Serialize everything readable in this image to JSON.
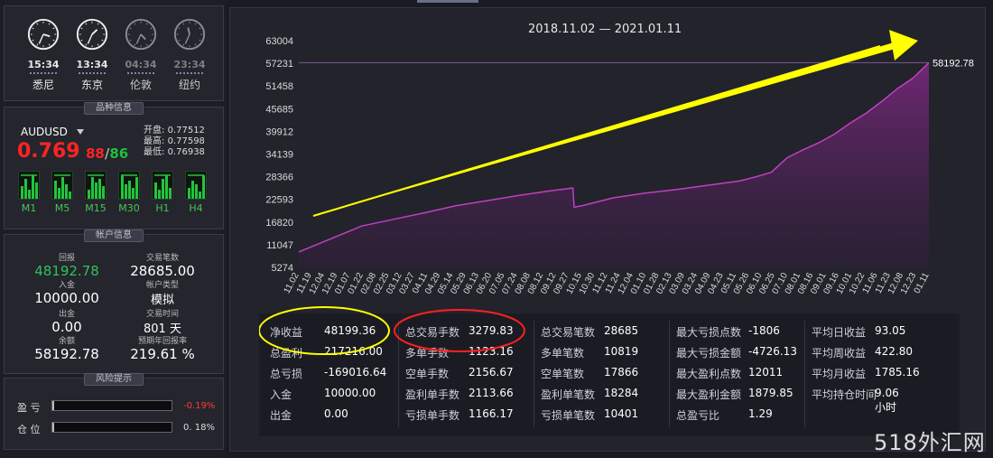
{
  "clocks": [
    {
      "time": "15:34",
      "city": "悉尼",
      "hour": 15,
      "minute": 34,
      "active": true
    },
    {
      "time": "13:34",
      "city": "东京",
      "hour": 13,
      "minute": 34,
      "active": true
    },
    {
      "time": "04:34",
      "city": "伦敦",
      "hour": 4,
      "minute": 34,
      "active": false
    },
    {
      "time": "23:34",
      "city": "纽约",
      "hour": 23,
      "minute": 34,
      "active": false
    }
  ],
  "symbol_panel": {
    "title": "品种信息",
    "symbol": "AUDUSD",
    "price_main": "0.769",
    "price_bid": "88",
    "price_sep": "/",
    "price_ask": "86",
    "open_label": "开盘:",
    "open": "0.77512",
    "high_label": "最高:",
    "high": "0.77598",
    "low_label": "最低:",
    "low": "0.76938",
    "timeframes": [
      "M1",
      "M5",
      "M15",
      "M30",
      "H1",
      "H4"
    ]
  },
  "account_panel": {
    "title": "帐户信息",
    "profit_label": "回报",
    "profit": "48192.78",
    "trades_label": "交易笔数",
    "trades": "28685.00",
    "deposit_label": "入金",
    "deposit": "10000.00",
    "account_type_label": "帐户类型",
    "account_type": "模拟",
    "withdraw_label": "出金",
    "withdraw": "0.00",
    "trade_time_label": "交易时间",
    "trade_time": "801 天",
    "balance_label": "余额",
    "balance": "58192.78",
    "annual_label": "预期年回报率",
    "annual": "219.61 %"
  },
  "risk_panel": {
    "title": "风险提示",
    "pl_label": "盈 亏",
    "pl_value": "-0.19%",
    "pl_fraction": 0.0019,
    "position_label": "仓 位",
    "position_value": "0. 18%",
    "position_fraction": 0.0018
  },
  "chart_data": {
    "type": "area",
    "title": "2018.11.02 — 2021.01.11",
    "last_value_label": "58192.78",
    "y_ticks": [
      "63004",
      "57231",
      "51458",
      "45685",
      "39912",
      "34139",
      "28366",
      "22593",
      "16820",
      "11047",
      "5274"
    ],
    "ylim": [
      5274,
      63004
    ],
    "x_ticks": [
      "11.02",
      "11.19",
      "12.04",
      "12.19",
      "01.07",
      "01.22",
      "02.08",
      "02.25",
      "03.12",
      "03.27",
      "04.11",
      "04.29",
      "05.14",
      "05.29",
      "06.13",
      "06.20",
      "07.05",
      "07.24",
      "08.08",
      "08.12",
      "09.12",
      "09.27",
      "10.15",
      "10.30",
      "11.12",
      "11.24",
      "12.04",
      "01.10",
      "01.28",
      "02.13",
      "03.09",
      "03.24",
      "04.09",
      "04.23",
      "05.11",
      "05.26",
      "06.10",
      "06.25",
      "07.10",
      "08.01",
      "08.16",
      "09.01",
      "09.16",
      "10.01",
      "10.22",
      "11.06",
      "11.23",
      "12.08",
      "12.23",
      "01.11"
    ],
    "series": [
      {
        "color": "#c040c0",
        "points": [
          [
            0,
            9200
          ],
          [
            0.05,
            12500
          ],
          [
            0.1,
            15800
          ],
          [
            0.15,
            17500
          ],
          [
            0.2,
            19200
          ],
          [
            0.25,
            21000
          ],
          [
            0.3,
            22300
          ],
          [
            0.35,
            23600
          ],
          [
            0.4,
            24800
          ],
          [
            0.435,
            25500
          ],
          [
            0.437,
            20600
          ],
          [
            0.45,
            21000
          ],
          [
            0.5,
            23000
          ],
          [
            0.55,
            24200
          ],
          [
            0.6,
            25100
          ],
          [
            0.65,
            26200
          ],
          [
            0.7,
            27300
          ],
          [
            0.725,
            28300
          ],
          [
            0.75,
            29500
          ],
          [
            0.775,
            33200
          ],
          [
            0.8,
            35200
          ],
          [
            0.825,
            37000
          ],
          [
            0.85,
            39200
          ],
          [
            0.875,
            42000
          ],
          [
            0.9,
            44500
          ],
          [
            0.925,
            47500
          ],
          [
            0.95,
            50800
          ],
          [
            0.975,
            53500
          ],
          [
            1.0,
            57400
          ]
        ]
      }
    ],
    "overlay_arrow": {
      "color": "#ffff00"
    }
  },
  "stats": {
    "columns": [
      [
        {
          "k": "净收益",
          "v": "48199.36"
        },
        {
          "k": "总盈利",
          "v": "217216.00"
        },
        {
          "k": "总亏损",
          "v": "-169016.64"
        },
        {
          "k": "入金",
          "v": "10000.00"
        },
        {
          "k": "出金",
          "v": "0.00"
        }
      ],
      [
        {
          "k": "总交易手数",
          "v": "3279.83"
        },
        {
          "k": "多单手数",
          "v": "1123.16"
        },
        {
          "k": "空单手数",
          "v": "2156.67"
        },
        {
          "k": "盈利单手数",
          "v": "2113.66"
        },
        {
          "k": "亏损单手数",
          "v": "1166.17"
        }
      ],
      [
        {
          "k": "总交易笔数",
          "v": "28685"
        },
        {
          "k": "多单笔数",
          "v": "10819"
        },
        {
          "k": "空单笔数",
          "v": "17866"
        },
        {
          "k": "盈利单笔数",
          "v": "18284"
        },
        {
          "k": "亏损单笔数",
          "v": "10401"
        }
      ],
      [
        {
          "k": "最大亏损点数",
          "v": "-1806"
        },
        {
          "k": "最大亏损金额",
          "v": "-4726.13"
        },
        {
          "k": "最大盈利点数",
          "v": "12011"
        },
        {
          "k": "最大盈利金额",
          "v": "1879.85"
        },
        {
          "k": "总盈亏比",
          "v": "1.29"
        }
      ],
      [
        {
          "k": "平均日收益",
          "v": "93.05"
        },
        {
          "k": "平均周收益",
          "v": "422.80"
        },
        {
          "k": "平均月收益",
          "v": "1785.16"
        },
        {
          "k": "平均持仓时间",
          "v": "9.06小时"
        }
      ]
    ]
  },
  "watermark": "518外汇网"
}
